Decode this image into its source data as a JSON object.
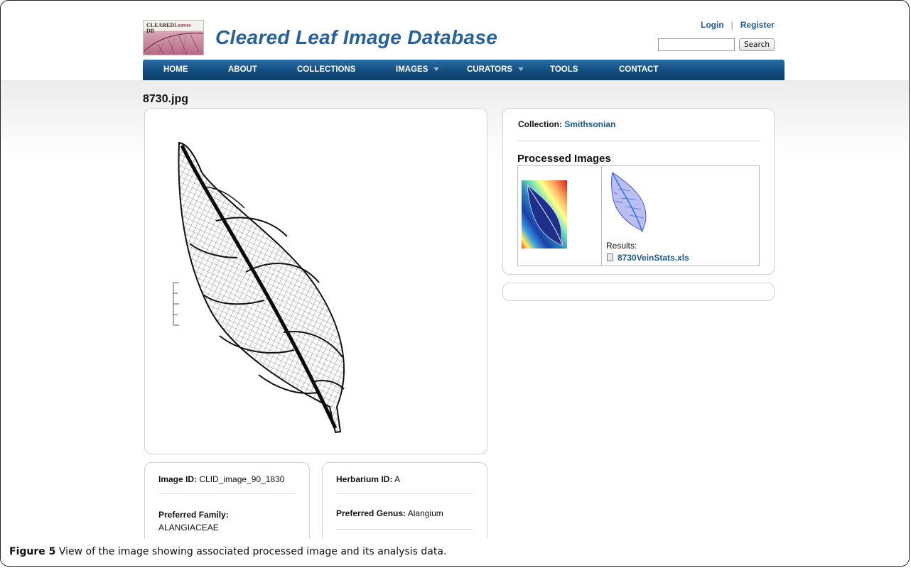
{
  "header": {
    "logo_text_top": "CLEARED",
    "logo_text_leaves": "Leaves",
    "logo_text_db": "DB",
    "site_title": "Cleared Leaf Image Database",
    "login_label": "Login",
    "register_label": "Register",
    "search_placeholder": "",
    "search_button": "Search"
  },
  "nav": {
    "items": [
      {
        "label": "HOME",
        "dropdown": false
      },
      {
        "label": "ABOUT",
        "dropdown": false
      },
      {
        "label": "COLLECTIONS",
        "dropdown": false
      },
      {
        "label": "IMAGES",
        "dropdown": true
      },
      {
        "label": "CURATORS",
        "dropdown": true
      },
      {
        "label": "TOOLS",
        "dropdown": false
      },
      {
        "label": "CONTACT",
        "dropdown": false
      }
    ]
  },
  "main": {
    "file_title": "8730.jpg",
    "collection_label": "Collection:",
    "collection_value": "Smithsonian",
    "processed_title": "Processed Images",
    "results_label": "Results:",
    "results_file": "8730VeinStats.xls",
    "info": {
      "image_id_label": "Image ID:",
      "image_id_value": "CLID_image_90_1830",
      "herbarium_id_label": "Herbarium ID:",
      "herbarium_id_value": "A",
      "family_label": "Preferred Family:",
      "family_value": "ALANGIACEAE",
      "genus_label": "Preferred Genus:",
      "genus_value": "Alangium"
    }
  },
  "caption": {
    "label": "Figure 5",
    "text": "View of the image showing associated processed image and its analysis data."
  },
  "colors": {
    "nav_bg": "#134d80",
    "link": "#1c5a90",
    "title": "#27609b"
  }
}
